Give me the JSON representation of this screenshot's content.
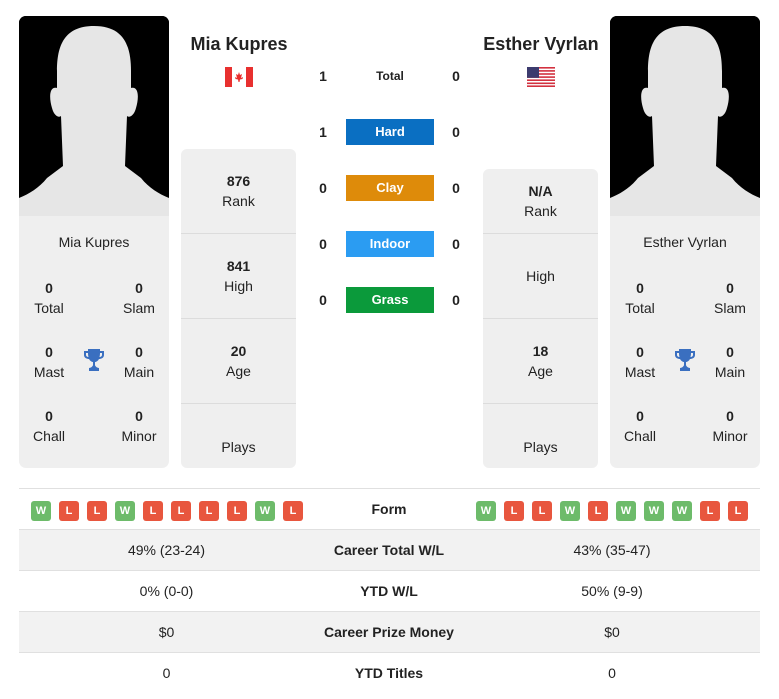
{
  "player_left": {
    "name": "Mia Kupres",
    "country_flag": "canada-flag",
    "card_name": "Mia Kupres",
    "titles": {
      "total": {
        "value": "0",
        "label": "Total"
      },
      "slam": {
        "value": "0",
        "label": "Slam"
      },
      "mast": {
        "value": "0",
        "label": "Mast"
      },
      "main": {
        "value": "0",
        "label": "Main"
      },
      "chall": {
        "value": "0",
        "label": "Chall"
      },
      "minor": {
        "value": "0",
        "label": "Minor"
      }
    },
    "info": {
      "rank": {
        "value": "876",
        "label": "Rank"
      },
      "high": {
        "value": "841",
        "label": "High"
      },
      "age": {
        "value": "20",
        "label": "Age"
      },
      "plays": {
        "value": "",
        "label": "Plays"
      }
    },
    "form": [
      "W",
      "L",
      "L",
      "W",
      "L",
      "L",
      "L",
      "L",
      "W",
      "L"
    ]
  },
  "player_right": {
    "name": "Esther Vyrlan",
    "country_flag": "usa-flag",
    "card_name": "Esther Vyrlan",
    "titles": {
      "total": {
        "value": "0",
        "label": "Total"
      },
      "slam": {
        "value": "0",
        "label": "Slam"
      },
      "mast": {
        "value": "0",
        "label": "Mast"
      },
      "main": {
        "value": "0",
        "label": "Main"
      },
      "chall": {
        "value": "0",
        "label": "Chall"
      },
      "minor": {
        "value": "0",
        "label": "Minor"
      }
    },
    "info": {
      "rank": {
        "value": "N/A",
        "label": "Rank"
      },
      "high": {
        "value": "",
        "label": "High"
      },
      "age": {
        "value": "18",
        "label": "Age"
      },
      "plays": {
        "value": "",
        "label": "Plays"
      }
    },
    "form": [
      "W",
      "L",
      "L",
      "W",
      "L",
      "W",
      "W",
      "W",
      "L",
      "L"
    ]
  },
  "h2h": [
    {
      "label": "Total",
      "left": "1",
      "right": "0",
      "color": null
    },
    {
      "label": "Hard",
      "left": "1",
      "right": "0",
      "color": "#0a6fc2"
    },
    {
      "label": "Clay",
      "left": "0",
      "right": "0",
      "color": "#de8b0a"
    },
    {
      "label": "Indoor",
      "left": "0",
      "right": "0",
      "color": "#2b9cf2"
    },
    {
      "label": "Grass",
      "left": "0",
      "right": "0",
      "color": "#0b9a3b"
    }
  ],
  "comparison": {
    "form_label": "Form",
    "rows": [
      {
        "label": "Career Total W/L",
        "left": "49% (23-24)",
        "right": "43% (35-47)"
      },
      {
        "label": "YTD W/L",
        "left": "0% (0-0)",
        "right": "50% (9-9)"
      },
      {
        "label": "Career Prize Money",
        "left": "$0",
        "right": "$0"
      },
      {
        "label": "YTD Titles",
        "left": "0",
        "right": "0"
      }
    ]
  },
  "colors": {
    "win": "#6dbb6a",
    "loss": "#e8563e",
    "trophy": "#3a6fc0"
  }
}
